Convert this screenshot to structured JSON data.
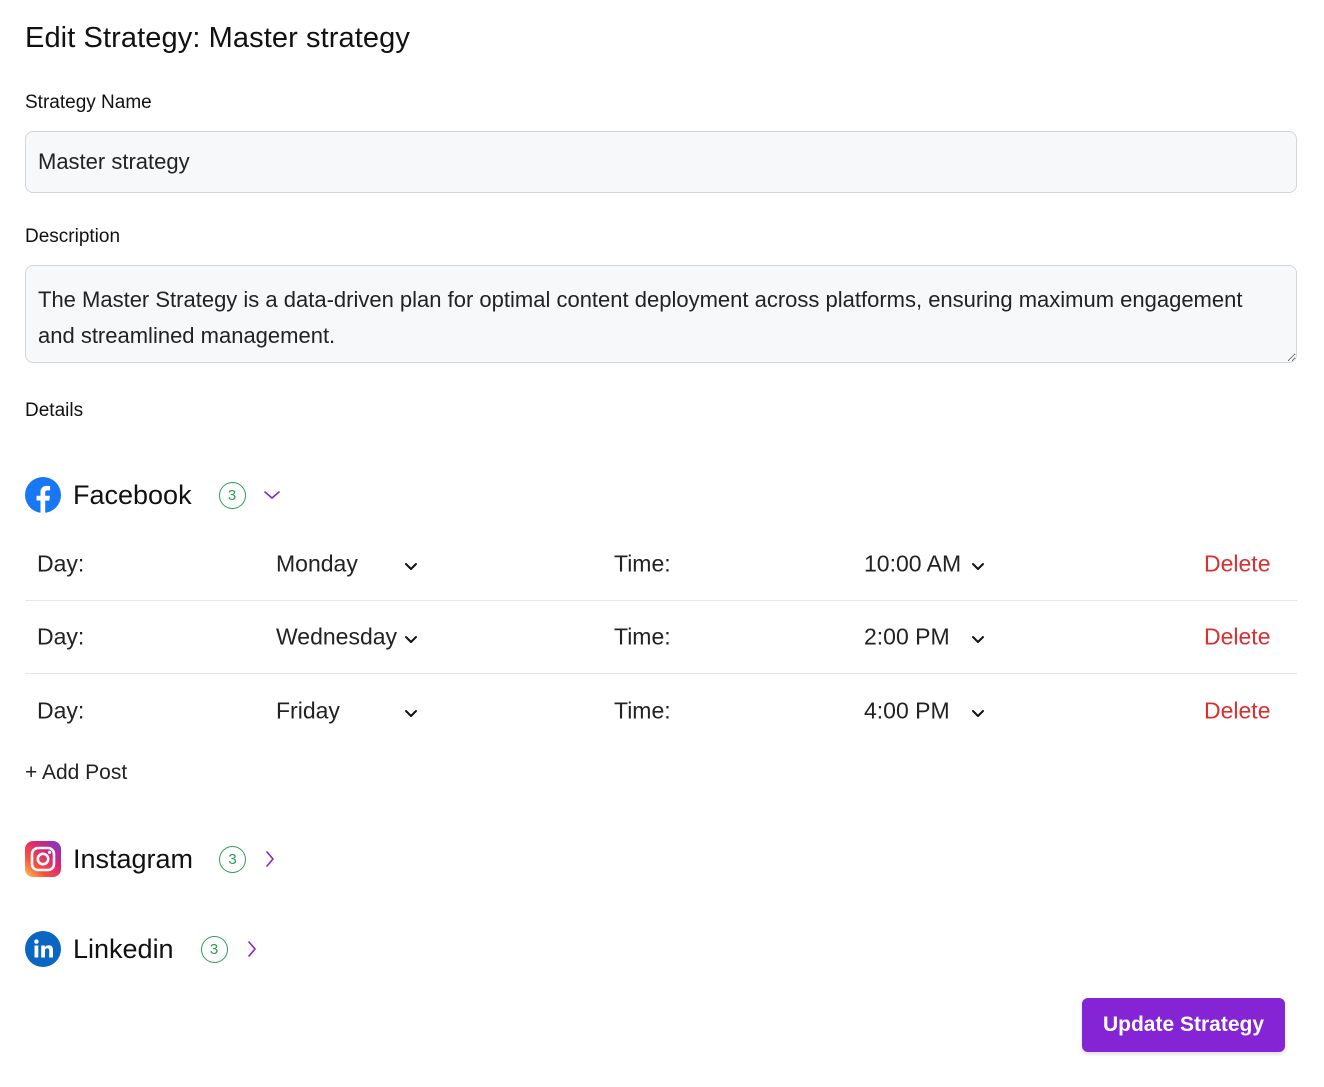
{
  "page": {
    "title": "Edit Strategy: Master strategy"
  },
  "form": {
    "name_label": "Strategy Name",
    "name_value": "Master strategy",
    "description_label": "Description",
    "description_value": "The Master Strategy is a data-driven plan for optimal content deployment across platforms, ensuring maximum engagement and streamlined management.",
    "details_label": "Details"
  },
  "platforms": [
    {
      "name": "Facebook",
      "icon": "facebook-icon",
      "count": "3",
      "expanded": true,
      "color": "#1877f2",
      "posts": [
        {
          "day_label": "Day:",
          "day": "Monday",
          "time_label": "Time:",
          "time": "10:00 AM",
          "delete_label": "Delete"
        },
        {
          "day_label": "Day:",
          "day": "Wednesday",
          "time_label": "Time:",
          "time": "2:00 PM",
          "delete_label": "Delete"
        },
        {
          "day_label": "Day:",
          "day": "Friday",
          "time_label": "Time:",
          "time": "4:00 PM",
          "delete_label": "Delete"
        }
      ],
      "add_post_label": "+ Add Post"
    },
    {
      "name": "Instagram",
      "icon": "instagram-icon",
      "count": "3",
      "expanded": false
    },
    {
      "name": "Linkedin",
      "icon": "linkedin-icon",
      "count": "3",
      "expanded": false,
      "color": "#0a66c2"
    }
  ],
  "actions": {
    "update_label": "Update Strategy"
  },
  "colors": {
    "accent": "#8424d4",
    "chevron": "#8424d4",
    "badge": "#2e9d54",
    "delete": "#dc2f2f"
  }
}
